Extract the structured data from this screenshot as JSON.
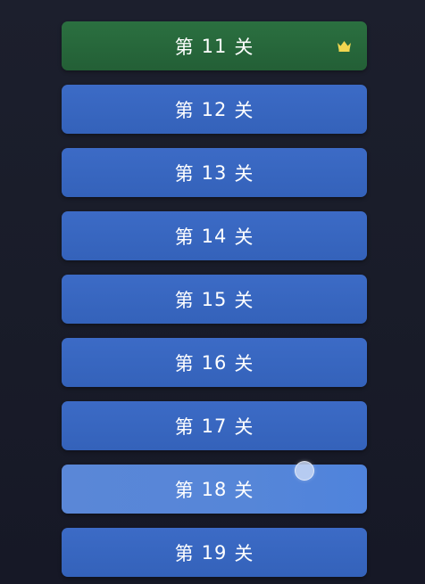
{
  "levels": [
    {
      "prefix": "第",
      "number": "11",
      "suffix": "关",
      "state": "completed",
      "badge": "crown-icon"
    },
    {
      "prefix": "第",
      "number": "12",
      "suffix": "关",
      "state": "available"
    },
    {
      "prefix": "第",
      "number": "13",
      "suffix": "关",
      "state": "available"
    },
    {
      "prefix": "第",
      "number": "14",
      "suffix": "关",
      "state": "available"
    },
    {
      "prefix": "第",
      "number": "15",
      "suffix": "关",
      "state": "available"
    },
    {
      "prefix": "第",
      "number": "16",
      "suffix": "关",
      "state": "available"
    },
    {
      "prefix": "第",
      "number": "17",
      "suffix": "关",
      "state": "available"
    },
    {
      "prefix": "第",
      "number": "18",
      "suffix": "关",
      "state": "hover"
    },
    {
      "prefix": "第",
      "number": "19",
      "suffix": "关",
      "state": "available"
    }
  ],
  "colors": {
    "background": "#1a1d2b",
    "level_available": "#3867c0",
    "level_completed": "#27683b",
    "level_hover": "#5686d8",
    "crown": "#f1d650",
    "text": "#ffffff"
  }
}
